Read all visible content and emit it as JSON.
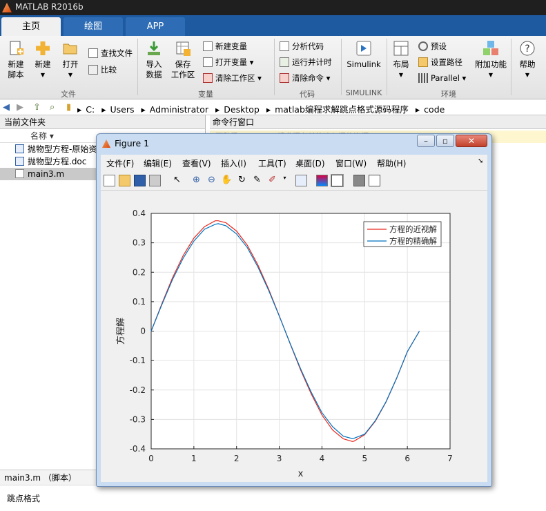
{
  "app": {
    "title": "MATLAB R2016b"
  },
  "tabs": [
    {
      "label": "主页"
    },
    {
      "label": "绘图"
    },
    {
      "label": "APP"
    }
  ],
  "ribbon": {
    "file": {
      "new_script": "新建\n脚本",
      "new": "新建",
      "open": "打开",
      "find_files": "查找文件",
      "compare": "比较",
      "group": "文件"
    },
    "variable": {
      "import": "导入\n数据",
      "save_ws": "保存\n工作区",
      "new_var": "新建变量",
      "open_var": "打开变量",
      "clear_ws": "清除工作区",
      "group": "变量"
    },
    "code": {
      "analyze": "分析代码",
      "run_time": "运行并计时",
      "clear_cmd": "清除命令",
      "group": "代码"
    },
    "simulink": {
      "label": "Simulink",
      "group": "SIMULINK"
    },
    "env": {
      "layout": "布局",
      "prefs": "预设",
      "set_path": "设置路径",
      "parallel": "Parallel",
      "addons": "附加功能",
      "group": "环境"
    },
    "help": {
      "label": "帮助"
    }
  },
  "address": {
    "crumbs": [
      "C:",
      "Users",
      "Administrator",
      "Desktop",
      "matlab编程求解跳点格式源码程序",
      "code"
    ]
  },
  "left_panel": {
    "title": "当前文件夹",
    "col_name": "名称",
    "files": [
      {
        "name": "抛物型方程-原始资",
        "type": "doc"
      },
      {
        "name": "抛物型方程.doc",
        "type": "doc"
      },
      {
        "name": "main3.m",
        "type": "m",
        "selected": true
      }
    ],
    "detail_title": "main3.m （脚本）",
    "detail_value": "跳点格式"
  },
  "right_panel": {
    "title": "命令行窗口",
    "hint": "不熟悉 MATLAB? 请参阅有关快速入门的资源。"
  },
  "figure": {
    "title": "Figure 1",
    "menu": [
      "文件(F)",
      "编辑(E)",
      "查看(V)",
      "插入(I)",
      "工具(T)",
      "桌面(D)",
      "窗口(W)",
      "帮助(H)"
    ]
  },
  "chart_data": {
    "type": "line",
    "title": "",
    "xlabel": "x",
    "ylabel": "方程解",
    "xlim": [
      0,
      7
    ],
    "ylim": [
      -0.4,
      0.4
    ],
    "xticks": [
      0,
      1,
      2,
      3,
      4,
      5,
      6,
      7
    ],
    "yticks": [
      0.4,
      0.3,
      0.2,
      0.1,
      0,
      -0.1,
      -0.2,
      -0.3,
      -0.4
    ],
    "grid": true,
    "legend_position": "top-right",
    "x": [
      0,
      0.25,
      0.5,
      0.75,
      1.0,
      1.25,
      1.5,
      1.571,
      1.75,
      2.0,
      2.25,
      2.5,
      2.75,
      3.0,
      3.25,
      3.5,
      3.75,
      4.0,
      4.25,
      4.5,
      4.712,
      4.75,
      5.0,
      5.25,
      5.5,
      5.75,
      6.0,
      6.283
    ],
    "series": [
      {
        "name": "方程的近视解",
        "color": "#e8281e",
        "values": [
          0,
          0.093,
          0.181,
          0.257,
          0.316,
          0.355,
          0.375,
          0.375,
          0.368,
          0.34,
          0.292,
          0.225,
          0.143,
          0.052,
          -0.041,
          -0.132,
          -0.214,
          -0.285,
          -0.336,
          -0.366,
          -0.375,
          -0.374,
          -0.352,
          -0.306,
          -0.241,
          -0.16,
          -0.07,
          0
        ]
      },
      {
        "name": "方程的精确解",
        "color": "#0072bd",
        "values": [
          0,
          0.09,
          0.175,
          0.248,
          0.306,
          0.346,
          0.363,
          0.365,
          0.358,
          0.33,
          0.284,
          0.218,
          0.139,
          0.051,
          -0.04,
          -0.128,
          -0.208,
          -0.277,
          -0.325,
          -0.357,
          -0.365,
          -0.364,
          -0.35,
          -0.304,
          -0.24,
          -0.159,
          -0.07,
          0
        ]
      }
    ]
  }
}
